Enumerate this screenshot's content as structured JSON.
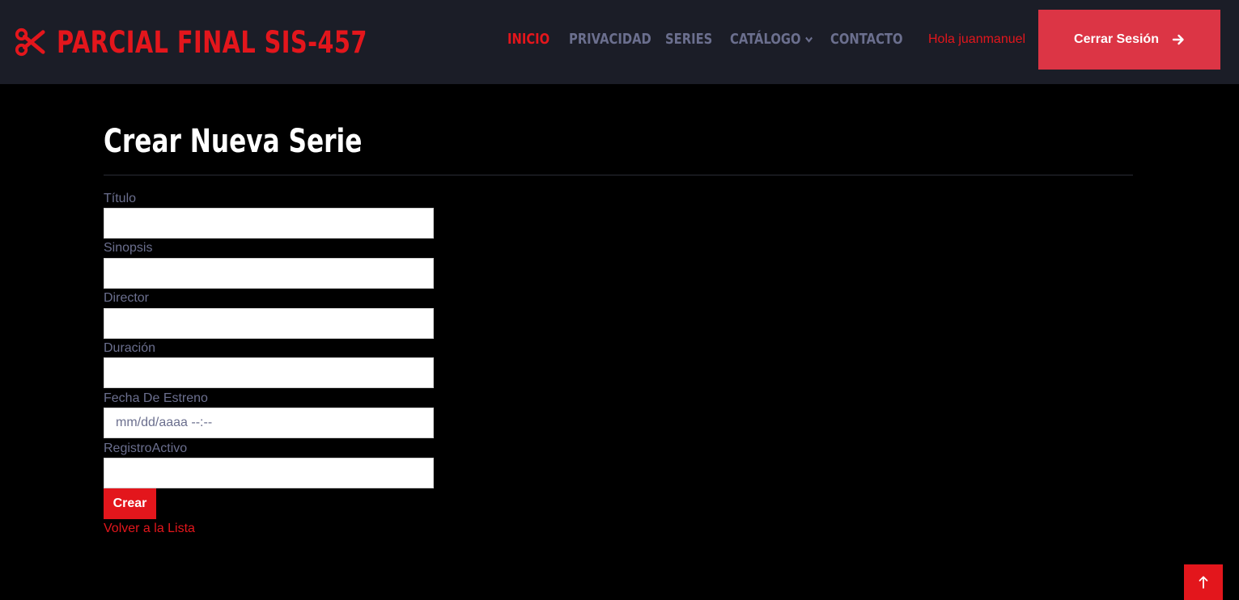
{
  "brand": {
    "title": "PARCIAL FINAL SIS-457",
    "icon": "scissors-icon"
  },
  "nav": {
    "items": [
      {
        "label": "INICIO",
        "active": true
      },
      {
        "label": "PRIVACIDAD",
        "active": false
      },
      {
        "label": "SERIES",
        "active": false
      },
      {
        "label": "CATÁLOGO",
        "active": false,
        "has_dropdown": true
      },
      {
        "label": "CONTACTO",
        "active": false
      }
    ],
    "greeting": "Hola juanmanuel",
    "logout_label": "Cerrar Sesión",
    "logout_icon": "arrow-right-icon"
  },
  "form": {
    "title": "Crear Nueva Serie",
    "fields": [
      {
        "label": "Título",
        "value": "",
        "placeholder": ""
      },
      {
        "label": "Sinopsis",
        "value": "",
        "placeholder": ""
      },
      {
        "label": "Director",
        "value": "",
        "placeholder": ""
      },
      {
        "label": "Duración",
        "value": "",
        "placeholder": ""
      },
      {
        "label": "Fecha De Estreno",
        "value": "",
        "placeholder": "mm/dd/aaaa --:--"
      },
      {
        "label": "RegistroActivo",
        "value": "",
        "placeholder": ""
      }
    ],
    "submit_label": "Crear",
    "back_link": "Volver a la Lista"
  },
  "scroll_top": {
    "label": "↑",
    "icon": "arrow-up-icon"
  },
  "colors": {
    "accent": "#e3161c",
    "logout_button": "#dc3545",
    "header_bg": "#1b1d27",
    "nav_text": "#6b6f8e",
    "page_bg": "#000000"
  }
}
